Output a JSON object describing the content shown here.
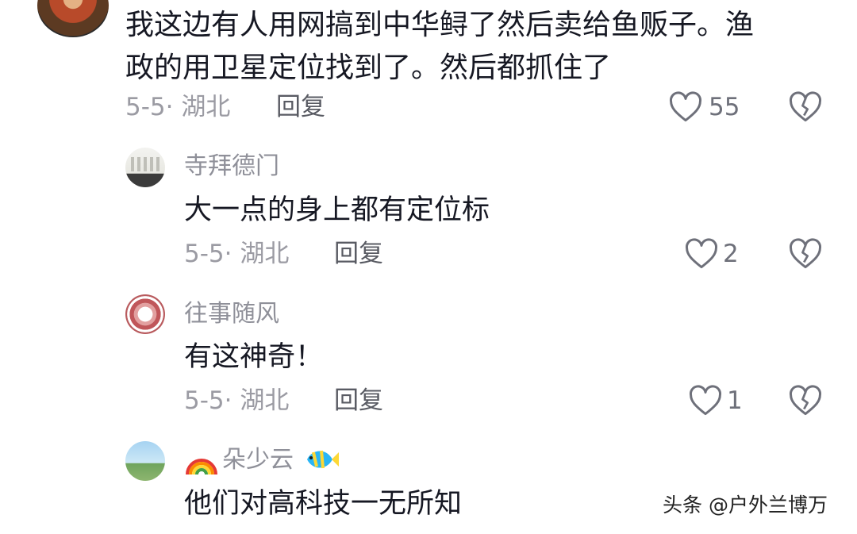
{
  "main_comment": {
    "text": "我这边有人用网搞到中华鲟了然后卖给鱼贩子。渔\n政的用卫星定位找到了。然后都抓住了",
    "date_location": "5-5· 湖北",
    "reply_label": "回复",
    "likes": "55"
  },
  "replies": [
    {
      "username": "寺拜德门",
      "text": "大一点的身上都有定位标",
      "date_location": "5-5· 湖北",
      "reply_label": "回复",
      "likes": "2"
    },
    {
      "username": "往事随风",
      "text": "有这神奇！",
      "date_location": "5-5· 湖北",
      "reply_label": "回复",
      "likes": "1"
    },
    {
      "username": "朵少云",
      "text": "他们对高科技一无所知"
    }
  ],
  "watermark": "头条 @户外兰博万",
  "icons": {
    "like": "heart-outline-icon",
    "dislike": "broken-heart-icon",
    "username_prefix": "rainbow-emoji",
    "username_suffix": "tropical-fish-emoji"
  },
  "colors": {
    "text_primary": "#161823",
    "text_secondary": "#9b9ba3",
    "icon_gray": "#6e707a"
  }
}
